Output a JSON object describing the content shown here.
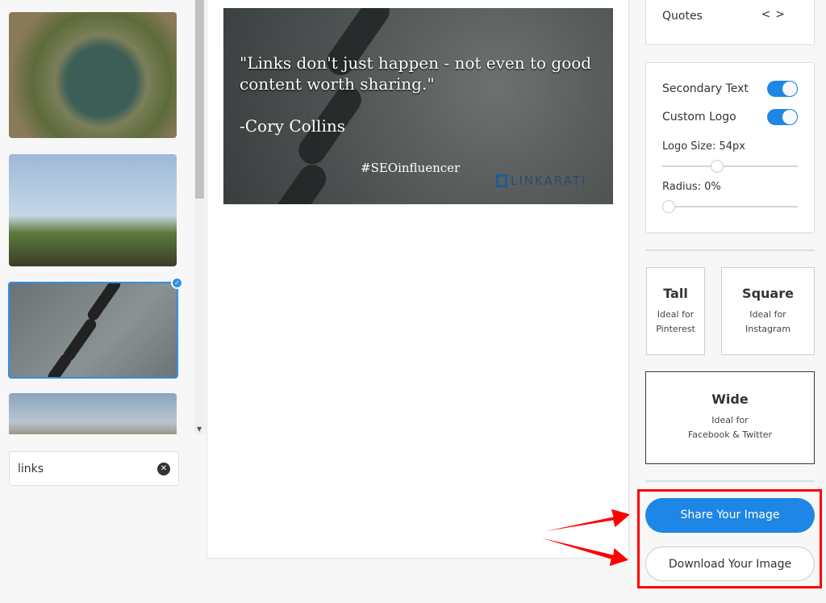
{
  "thumbnails": [
    {
      "name": "marina"
    },
    {
      "name": "sky-plants"
    },
    {
      "name": "chain",
      "selected": true
    },
    {
      "name": "fence"
    }
  ],
  "search": {
    "value": "links"
  },
  "preview": {
    "quote": "\"Links don't just happen - not even to good content worth sharing.\"",
    "author": "-Cory Collins",
    "hashtag": "#SEOinfluencer",
    "logo": "LINKARATI"
  },
  "quotes": {
    "label": "Quotes",
    "prev": "<",
    "next": ">"
  },
  "options": {
    "secondary_text": "Secondary Text",
    "secondary_on": true,
    "custom_logo": "Custom Logo",
    "custom_logo_on": true,
    "logo_size": "Logo Size: 54px",
    "logo_size_value": 54,
    "radius": "Radius: 0%",
    "radius_value": 0
  },
  "formats": [
    {
      "title": "Tall",
      "desc1": "Ideal for",
      "desc2": "Pinterest"
    },
    {
      "title": "Square",
      "desc1": "Ideal for",
      "desc2": "Instagram"
    },
    {
      "title": "Wide",
      "desc1": "Ideal for",
      "desc2": "Facebook & Twitter",
      "selected": true
    }
  ],
  "actions": {
    "share": "Share Your Image",
    "download": "Download Your Image"
  },
  "colors": {
    "accent": "#1e86e4",
    "highlight": "#ff0000"
  }
}
